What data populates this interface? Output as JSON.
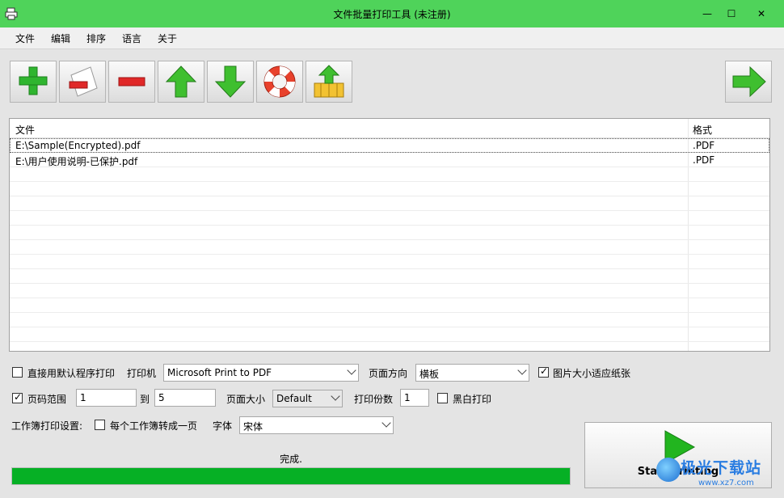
{
  "window": {
    "title": "文件批量打印工具 (未注册)",
    "minimize_glyph": "—",
    "maximize_glyph": "☐",
    "close_glyph": "✕"
  },
  "menu": [
    "文件",
    "编辑",
    "排序",
    "语言",
    "关于"
  ],
  "toolbar": {
    "buttons": [
      {
        "name": "add-files-button",
        "icon": "plus-icon"
      },
      {
        "name": "remove-file-button",
        "icon": "remove-document-icon"
      },
      {
        "name": "remove-all-button",
        "icon": "minus-icon"
      },
      {
        "name": "move-up-button",
        "icon": "arrow-up-icon"
      },
      {
        "name": "move-down-button",
        "icon": "arrow-down-icon"
      },
      {
        "name": "help-button",
        "icon": "lifebuoy-icon"
      },
      {
        "name": "export-button",
        "icon": "basket-upload-icon"
      },
      {
        "name": "next-button",
        "icon": "arrow-right-icon"
      }
    ]
  },
  "file_list": {
    "headers": {
      "file": "文件",
      "format": "格式"
    },
    "rows": [
      {
        "file": "E:\\Sample(Encrypted).pdf",
        "format": ".PDF"
      },
      {
        "file": "E:\\用户使用说明-已保护.pdf",
        "format": ".PDF"
      }
    ]
  },
  "options": {
    "use_default_program": {
      "label": "直接用默认程序打印",
      "checked": false
    },
    "printer": {
      "label": "打印机",
      "value": "Microsoft Print to PDF"
    },
    "orientation": {
      "label": "页面方向",
      "value": "横板"
    },
    "fit_image": {
      "label": "图片大小适应纸张",
      "checked": true
    },
    "page_range": {
      "label": "页码范围",
      "checked": true,
      "from": "1",
      "to_label": "到",
      "to": "5"
    },
    "page_size": {
      "label": "页面大小",
      "value": "Default"
    },
    "copies": {
      "label": "打印份数",
      "value": "1"
    },
    "grayscale": {
      "label": "黑白打印",
      "checked": false
    },
    "workbook": {
      "label": "工作簿打印设置:",
      "per_sheet_label": "每个工作簿转成一页",
      "checked": false
    },
    "font": {
      "label": "字体",
      "value": "宋体"
    }
  },
  "status": {
    "text": "完成.",
    "progress": 1.0
  },
  "start_button": {
    "label": "Start Printing"
  },
  "watermark": {
    "main": "极光下载站",
    "url": "www.xz7.com"
  },
  "colors": {
    "titlebar": "#4fd35a",
    "progress": "#06b025",
    "play": "#22b51f"
  }
}
